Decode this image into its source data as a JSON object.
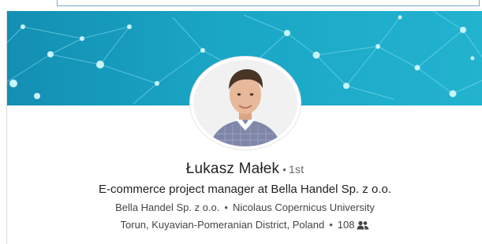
{
  "profile": {
    "name": "Łukasz Małek",
    "degree_separator": "•",
    "degree": "1st",
    "headline": "E-commerce project manager at Bella Handel Sp. z o.o.",
    "company": "Bella Handel Sp. z o.o.",
    "education": "Nicolaus Copernicus University",
    "location": "Torun, Kuyavian-Pomeranian District, Poland",
    "connections_count": "108",
    "separator": "•",
    "connections_icon": "people-icon"
  },
  "banner": {
    "style": "network-dots",
    "colors": {
      "start": "#138fb3",
      "end": "#22b3cf"
    }
  },
  "avatar": {
    "icon": "profile-photo"
  }
}
